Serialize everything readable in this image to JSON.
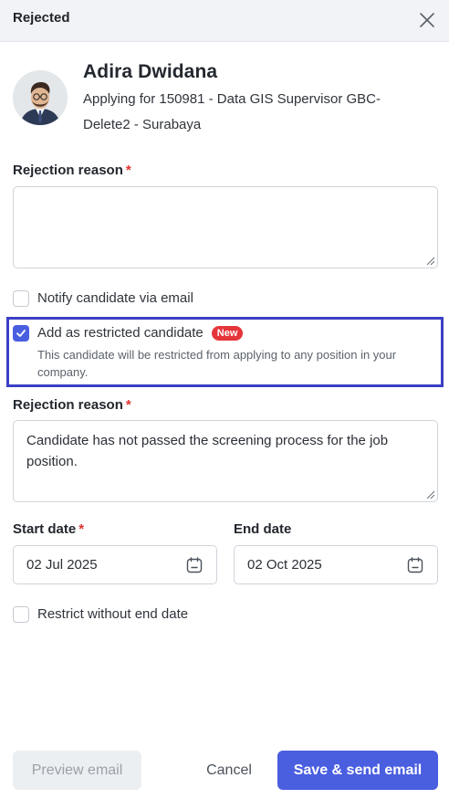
{
  "header": {
    "title": "Rejected"
  },
  "candidate": {
    "name": "Adira Dwidana",
    "applying_line1": "Applying for 150981 - Data GIS Supervisor GBC-",
    "applying_line2": "Delete2 - Surabaya"
  },
  "rejection_reason_1": {
    "label": "Rejection reason",
    "required_mark": "*",
    "value": ""
  },
  "notify": {
    "label": "Notify candidate via email",
    "checked": false
  },
  "restricted": {
    "label": "Add as restricted candidate",
    "badge": "New",
    "description": "This candidate will be restricted from applying to any position in your company.",
    "checked": true
  },
  "rejection_reason_2": {
    "label": "Rejection reason",
    "required_mark": "*",
    "value": "Candidate has not passed the screening process for the job position."
  },
  "start_date": {
    "label": "Start date",
    "required_mark": "*",
    "value": "02 Jul 2025"
  },
  "end_date": {
    "label": "End date",
    "value": "02 Oct 2025"
  },
  "no_end_date": {
    "label": "Restrict without end date",
    "checked": false
  },
  "footer": {
    "preview_label": "Preview email",
    "cancel_label": "Cancel",
    "save_label": "Save & send email"
  },
  "colors": {
    "primary": "#4a5ee0",
    "required": "#e0332f",
    "badge": "#e5353a",
    "highlight_border": "#3d3fc6"
  }
}
